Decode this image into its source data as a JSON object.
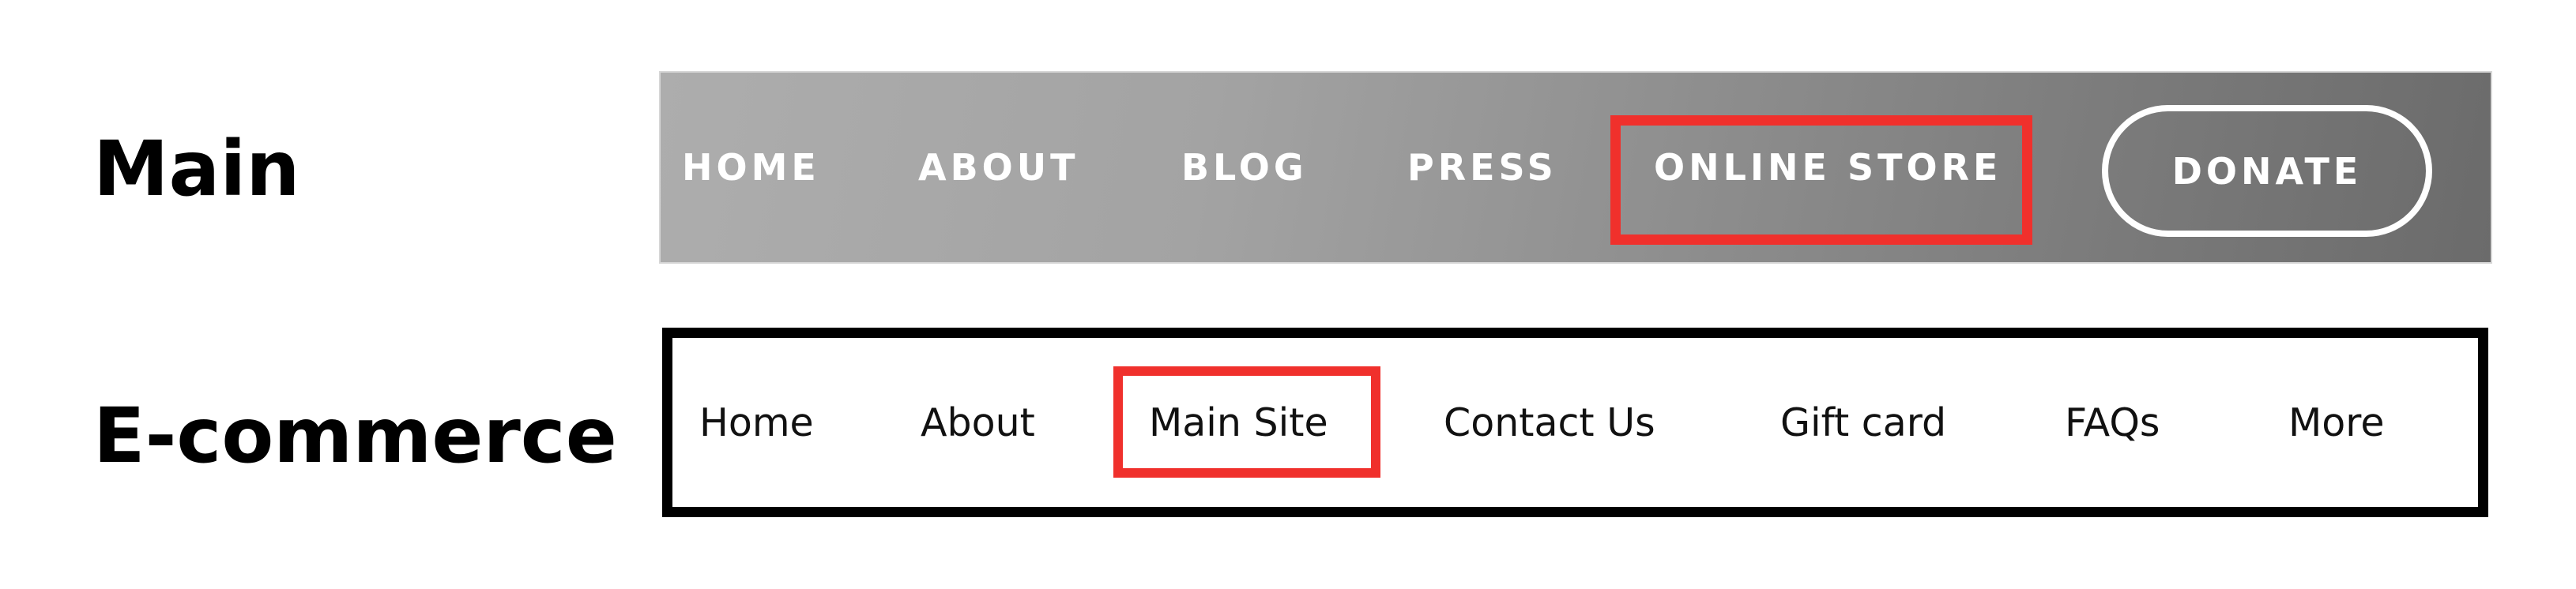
{
  "labels": {
    "main": "Main",
    "ecommerce": "E-commerce"
  },
  "main_nav": {
    "items": [
      {
        "label": "HOME"
      },
      {
        "label": "ABOUT"
      },
      {
        "label": "BLOG"
      },
      {
        "label": "PRESS"
      },
      {
        "label": "ONLINE STORE",
        "highlighted": true
      }
    ],
    "donate_label": "DONATE"
  },
  "ecommerce_nav": {
    "items": [
      {
        "label": "Home"
      },
      {
        "label": "About"
      },
      {
        "label": "Main Site",
        "highlighted": true
      },
      {
        "label": "Contact Us"
      },
      {
        "label": "Gift card"
      },
      {
        "label": "FAQs"
      },
      {
        "label": "More"
      }
    ]
  },
  "colors": {
    "highlight": "#f0302c",
    "main_bar_start": "#adadad",
    "main_bar_end": "#6b6b6b",
    "ecom_border": "#000000"
  }
}
